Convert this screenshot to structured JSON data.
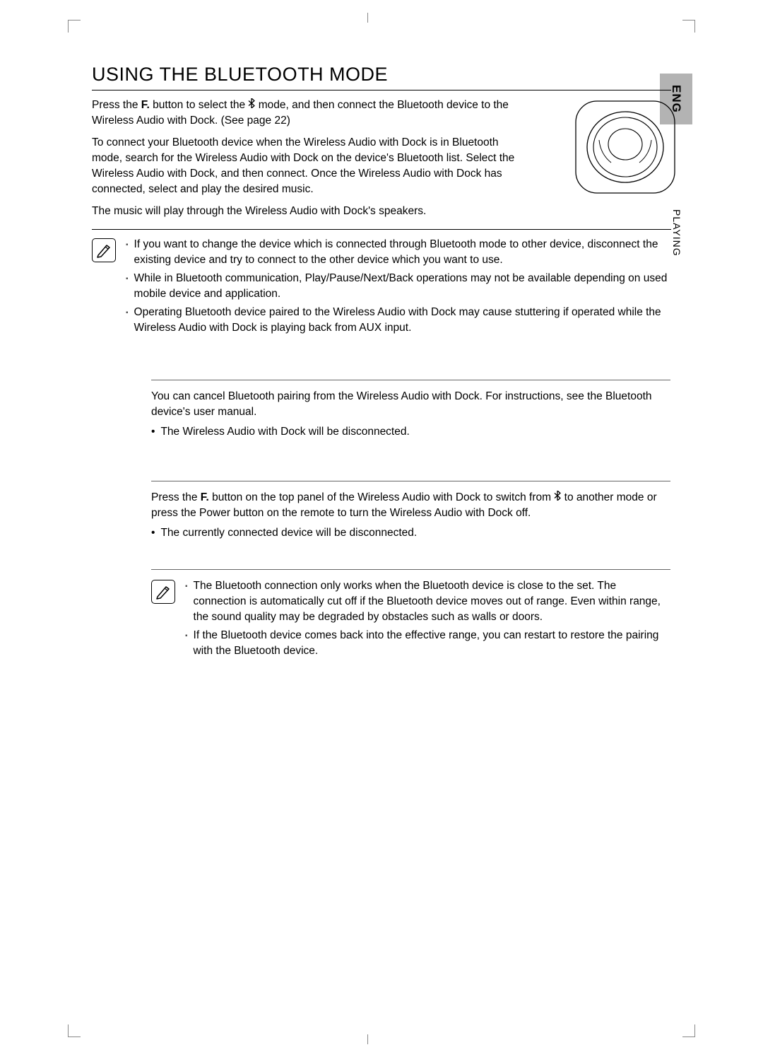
{
  "lang_tab": "ENG",
  "section_label": "PLAYING",
  "heading": "USING THE BLUETOOTH MODE",
  "intro": {
    "p1_a": "Press the ",
    "f_label": "F.",
    "p1_b": " button to select the ",
    "p1_c": " mode, and then connect the Bluetooth device to the Wireless Audio with Dock. (See page 22)",
    "p2": "To connect your Bluetooth device when the Wireless Audio with Dock is in Bluetooth mode, search for the Wireless Audio with Dock on the device's Bluetooth list. Select the Wireless Audio with Dock, and then connect. Once the Wireless Audio with Dock has connected, select and play the desired music.",
    "p3": "The music will play through the Wireless Audio with Dock's speakers."
  },
  "notes1": [
    "If you want to change the device which is connected through Bluetooth mode to other device, disconnect the existing device and try to connect to the other device which you want to use.",
    "While in Bluetooth communication, Play/Pause/Next/Back operations may not be available depending on used mobile device and application.",
    "Operating Bluetooth device paired to the Wireless Audio with Dock may cause stuttering if operated while the Wireless Audio with Dock is playing back from AUX input."
  ],
  "subsections": [
    {
      "head_line1": "",
      "head_line2": "",
      "body": "You can cancel Bluetooth pairing from the Wireless Audio with Dock. For instructions, see the Bluetooth device's user manual.",
      "bullet": "The Wireless Audio with Dock will be disconnected."
    },
    {
      "head_line1": "",
      "head_line2": "",
      "body_a": "Press the ",
      "body_b": " button on the top panel of the Wireless Audio with Dock to switch from ",
      "body_c": " to another mode or press the Power button on the remote to turn the Wireless Audio with Dock off.",
      "bullet": "The currently connected device will be disconnected."
    }
  ],
  "notes2": [
    "The Bluetooth connection only works when the Bluetooth device is close to the set. The connection is automatically cut off if the Bluetooth device moves out of range. Even within range, the sound quality may be degraded by obstacles such as walls or doors.",
    "If the Bluetooth device comes back into the effective range, you can restart to restore the pairing with the Bluetooth device."
  ],
  "page_number": ""
}
